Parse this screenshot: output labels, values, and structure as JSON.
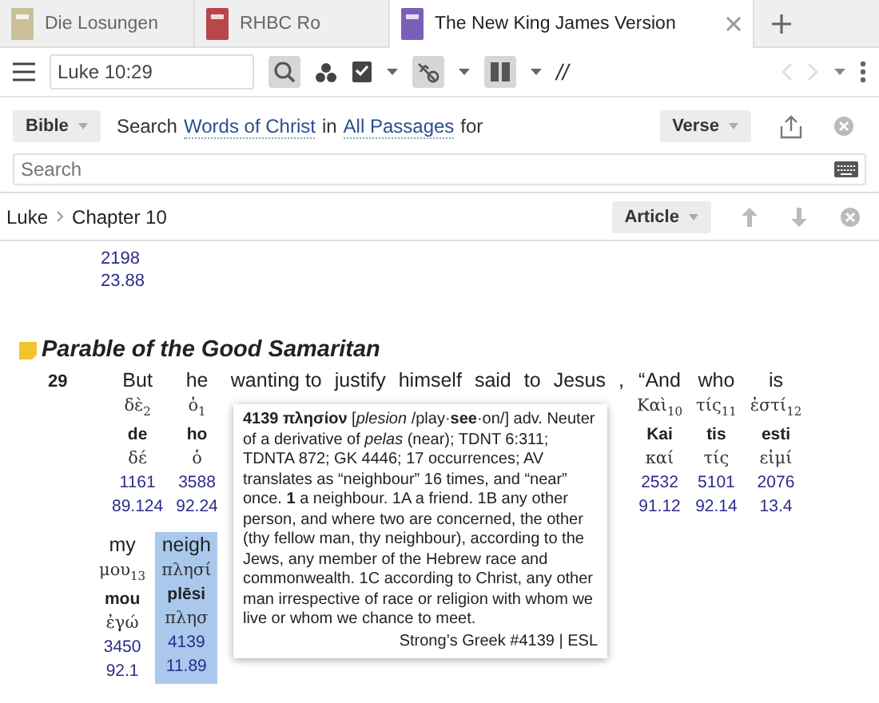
{
  "tabs": [
    {
      "label": "Die Losungen",
      "selected": false,
      "color": "#c9bf98"
    },
    {
      "label": "RHBC Ro",
      "selected": false,
      "color": "#b8474a"
    },
    {
      "label": "The New King James Version",
      "selected": true,
      "color": "#7a5fb8"
    }
  ],
  "toolbar": {
    "reference": "Luke 10:29",
    "parallel_mark": "//"
  },
  "search": {
    "resource": "Bible",
    "parts": [
      {
        "kind": "text",
        "text": "Search"
      },
      {
        "kind": "link",
        "text": "Words of Christ"
      },
      {
        "kind": "text",
        "text": "in"
      },
      {
        "kind": "link",
        "text": "All Passages"
      },
      {
        "kind": "text",
        "text": "for"
      }
    ],
    "view": "Verse",
    "placeholder": "Search"
  },
  "header": {
    "breadcrumb": [
      "Luke",
      "Chapter 10"
    ],
    "view": "Article"
  },
  "content": {
    "previous_numbers": [
      "2198",
      "23.88"
    ],
    "heading": "Parable of the Good Samaritan",
    "verse_number": "29",
    "row_1": [
      {
        "english": "But",
        "greek": "δὲ",
        "index": "2",
        "translit": "de",
        "lemma": "δέ",
        "strongs": "1161",
        "louw_nida": "89.124",
        "selected": false
      },
      {
        "english": "he",
        "greek": "ὁ",
        "index": "1",
        "translit": "ho",
        "lemma": "ὁ",
        "strongs": "3588",
        "louw_nida": "92.24",
        "selected": false
      },
      {
        "english": "wanting to",
        "selected": false
      },
      {
        "english": "justify",
        "selected": false
      },
      {
        "english": "himself",
        "selected": false
      },
      {
        "english": "said",
        "selected": false
      },
      {
        "english": "to",
        "selected": false
      },
      {
        "english": "Jesus",
        "selected": false
      },
      {
        "english": ",",
        "selected": false
      },
      {
        "english": "“And",
        "greek": "Καὶ",
        "index": "10",
        "translit": "Kai",
        "lemma": "καί",
        "strongs": "2532",
        "louw_nida": "91.12",
        "selected": false
      },
      {
        "english": "who",
        "greek": "τίς",
        "index": "11",
        "translit": "tis",
        "lemma": "τίς",
        "strongs": "5101",
        "louw_nida": "92.14",
        "selected": false
      },
      {
        "english": "is",
        "greek": "ἐστί",
        "index": "12",
        "translit": "esti",
        "lemma": "εἰμί",
        "strongs": "2076",
        "louw_nida": "13.4",
        "selected": false
      }
    ],
    "row_2": [
      {
        "english": "my",
        "greek": "μου",
        "index": "13",
        "translit": "mou",
        "lemma": "ἐγώ",
        "strongs": "3450",
        "louw_nida": "92.1",
        "selected": false
      },
      {
        "english": "neigh",
        "greek": "πλησί",
        "translit": "plēsi",
        "lemma": "πλησ",
        "strongs": "4139",
        "louw_nida": "11.89",
        "selected": true
      }
    ],
    "tooltip": {
      "text": "**4139 πλησίον** [*plesion* /play·**see**·on/] adv. Neuter of a derivative of *pelas* (near); TDNT 6:311; TDNTA 872; GK 4446; 17 occurrences; AV translates as “neighbour” 16 times, and “near” once. **1** a neighbour. 1A a friend. 1B any other person, and where two are concerned, the other (thy fellow man, thy neighbour), according to the Jews, any member of the Hebrew race and commonwealth. 1C according to Christ, any other man irrespective of race or religion with whom we live or whom we chance to meet.",
      "source": "Strong’s Greek #4139 | ESL"
    }
  }
}
